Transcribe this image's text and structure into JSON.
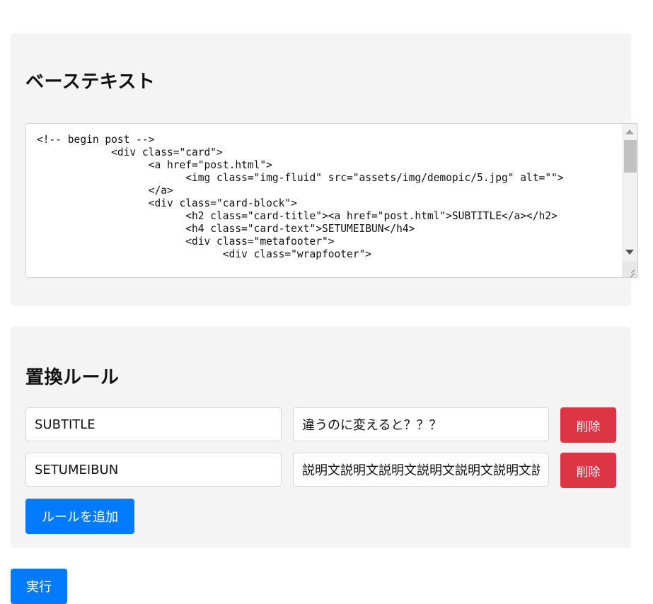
{
  "base_section": {
    "title": "ベーステキスト",
    "code": "<!-- begin post -->\n\t\t<div class=\"card\">\n\t\t\t<a href=\"post.html\">\n\t\t\t\t<img class=\"img-fluid\" src=\"assets/img/demopic/5.jpg\" alt=\"\">\n\t\t\t</a>\n\t\t\t<div class=\"card-block\">\n\t\t\t\t<h2 class=\"card-title\"><a href=\"post.html\">SUBTITLE</a></h2>\n\t\t\t\t<h4 class=\"card-text\">SETUMEIBUN</h4>\n\t\t\t\t<div class=\"metafooter\">\n\t\t\t\t\t<div class=\"wrapfooter\">"
  },
  "rules_section": {
    "title": "置換ルール",
    "rules": [
      {
        "search": "SUBTITLE",
        "replace": "違うのに変えると？？？",
        "delete_label": "削除"
      },
      {
        "search": "SETUMEIBUN",
        "replace": "説明文説明文説明文説明文説明文説明文説明文説明文",
        "delete_label": "削除"
      }
    ],
    "add_rule_label": "ルールを追加"
  },
  "run_label": "実行"
}
